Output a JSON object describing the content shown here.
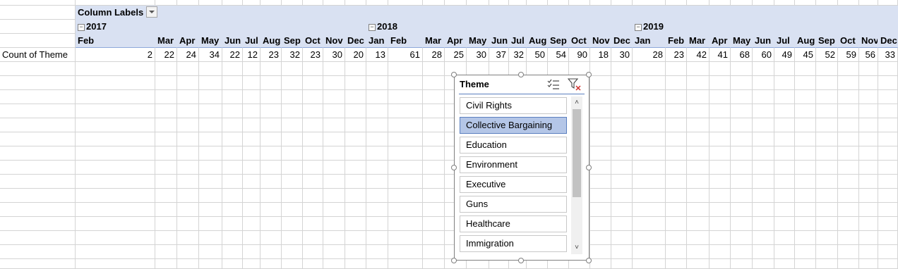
{
  "pivot": {
    "column_labels_caption": "Column Labels",
    "row_label": "Count of Theme",
    "years": [
      {
        "label": "2017",
        "collapse_symbol": "−",
        "months": [
          "Feb",
          "Mar",
          "Apr",
          "May",
          "Jun",
          "Jul",
          "Aug",
          "Sep",
          "Oct",
          "Nov",
          "Dec"
        ],
        "values": [
          2,
          22,
          24,
          34,
          22,
          12,
          23,
          32,
          23,
          30,
          20
        ]
      },
      {
        "label": "2018",
        "collapse_symbol": "−",
        "months": [
          "Jan",
          "Feb",
          "Mar",
          "Apr",
          "May",
          "Jun",
          "Jul",
          "Aug",
          "Sep",
          "Oct",
          "Nov",
          "Dec"
        ],
        "values": [
          13,
          61,
          28,
          25,
          30,
          37,
          32,
          50,
          54,
          90,
          18,
          30
        ]
      },
      {
        "label": "2019",
        "collapse_symbol": "−",
        "months": [
          "Jan",
          "Feb",
          "Mar",
          "Apr",
          "May",
          "Jun",
          "Jul",
          "Aug",
          "Sep",
          "Oct",
          "Nov",
          "Dec"
        ],
        "values": [
          28,
          23,
          42,
          41,
          68,
          60,
          49,
          45,
          52,
          59,
          56,
          33
        ]
      }
    ]
  },
  "slicer": {
    "title": "Theme",
    "items": [
      "Civil Rights",
      "Collective Bargaining",
      "Education",
      "Environment",
      "Executive",
      "Guns",
      "Healthcare",
      "Immigration"
    ],
    "selected_index": 1,
    "icons": [
      "multi-select-icon",
      "clear-filter-icon"
    ],
    "scroll_up_glyph": "˄",
    "scroll_down_glyph": "˅"
  },
  "colors": {
    "header_fill": "#d9e1f2",
    "slicer_selected": "#b4c6e7",
    "gridline": "#d4d4d4"
  }
}
